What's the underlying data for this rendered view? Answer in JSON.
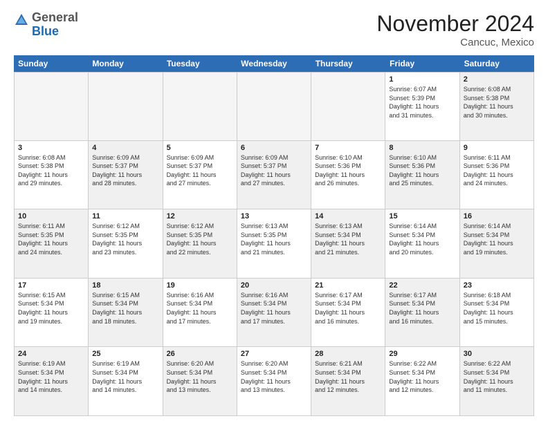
{
  "logo": {
    "general": "General",
    "blue": "Blue"
  },
  "header": {
    "month": "November 2024",
    "location": "Cancuc, Mexico"
  },
  "weekdays": [
    "Sunday",
    "Monday",
    "Tuesday",
    "Wednesday",
    "Thursday",
    "Friday",
    "Saturday"
  ],
  "rows": [
    [
      {
        "day": "",
        "info": "",
        "empty": true
      },
      {
        "day": "",
        "info": "",
        "empty": true
      },
      {
        "day": "",
        "info": "",
        "empty": true
      },
      {
        "day": "",
        "info": "",
        "empty": true
      },
      {
        "day": "",
        "info": "",
        "empty": true
      },
      {
        "day": "1",
        "info": "Sunrise: 6:07 AM\nSunset: 5:39 PM\nDaylight: 11 hours and 31 minutes.",
        "empty": false
      },
      {
        "day": "2",
        "info": "Sunrise: 6:08 AM\nSunset: 5:38 PM\nDaylight: 11 hours and 30 minutes.",
        "empty": false,
        "shaded": true
      }
    ],
    [
      {
        "day": "3",
        "info": "Sunrise: 6:08 AM\nSunset: 5:38 PM\nDaylight: 11 hours and 29 minutes.",
        "empty": false
      },
      {
        "day": "4",
        "info": "Sunrise: 6:09 AM\nSunset: 5:37 PM\nDaylight: 11 hours and 28 minutes.",
        "empty": false,
        "shaded": true
      },
      {
        "day": "5",
        "info": "Sunrise: 6:09 AM\nSunset: 5:37 PM\nDaylight: 11 hours and 27 minutes.",
        "empty": false
      },
      {
        "day": "6",
        "info": "Sunrise: 6:09 AM\nSunset: 5:37 PM\nDaylight: 11 hours and 27 minutes.",
        "empty": false,
        "shaded": true
      },
      {
        "day": "7",
        "info": "Sunrise: 6:10 AM\nSunset: 5:36 PM\nDaylight: 11 hours and 26 minutes.",
        "empty": false
      },
      {
        "day": "8",
        "info": "Sunrise: 6:10 AM\nSunset: 5:36 PM\nDaylight: 11 hours and 25 minutes.",
        "empty": false,
        "shaded": true
      },
      {
        "day": "9",
        "info": "Sunrise: 6:11 AM\nSunset: 5:36 PM\nDaylight: 11 hours and 24 minutes.",
        "empty": false
      }
    ],
    [
      {
        "day": "10",
        "info": "Sunrise: 6:11 AM\nSunset: 5:35 PM\nDaylight: 11 hours and 24 minutes.",
        "empty": false,
        "shaded": true
      },
      {
        "day": "11",
        "info": "Sunrise: 6:12 AM\nSunset: 5:35 PM\nDaylight: 11 hours and 23 minutes.",
        "empty": false
      },
      {
        "day": "12",
        "info": "Sunrise: 6:12 AM\nSunset: 5:35 PM\nDaylight: 11 hours and 22 minutes.",
        "empty": false,
        "shaded": true
      },
      {
        "day": "13",
        "info": "Sunrise: 6:13 AM\nSunset: 5:35 PM\nDaylight: 11 hours and 21 minutes.",
        "empty": false
      },
      {
        "day": "14",
        "info": "Sunrise: 6:13 AM\nSunset: 5:34 PM\nDaylight: 11 hours and 21 minutes.",
        "empty": false,
        "shaded": true
      },
      {
        "day": "15",
        "info": "Sunrise: 6:14 AM\nSunset: 5:34 PM\nDaylight: 11 hours and 20 minutes.",
        "empty": false
      },
      {
        "day": "16",
        "info": "Sunrise: 6:14 AM\nSunset: 5:34 PM\nDaylight: 11 hours and 19 minutes.",
        "empty": false,
        "shaded": true
      }
    ],
    [
      {
        "day": "17",
        "info": "Sunrise: 6:15 AM\nSunset: 5:34 PM\nDaylight: 11 hours and 19 minutes.",
        "empty": false
      },
      {
        "day": "18",
        "info": "Sunrise: 6:15 AM\nSunset: 5:34 PM\nDaylight: 11 hours and 18 minutes.",
        "empty": false,
        "shaded": true
      },
      {
        "day": "19",
        "info": "Sunrise: 6:16 AM\nSunset: 5:34 PM\nDaylight: 11 hours and 17 minutes.",
        "empty": false
      },
      {
        "day": "20",
        "info": "Sunrise: 6:16 AM\nSunset: 5:34 PM\nDaylight: 11 hours and 17 minutes.",
        "empty": false,
        "shaded": true
      },
      {
        "day": "21",
        "info": "Sunrise: 6:17 AM\nSunset: 5:34 PM\nDaylight: 11 hours and 16 minutes.",
        "empty": false
      },
      {
        "day": "22",
        "info": "Sunrise: 6:17 AM\nSunset: 5:34 PM\nDaylight: 11 hours and 16 minutes.",
        "empty": false,
        "shaded": true
      },
      {
        "day": "23",
        "info": "Sunrise: 6:18 AM\nSunset: 5:34 PM\nDaylight: 11 hours and 15 minutes.",
        "empty": false
      }
    ],
    [
      {
        "day": "24",
        "info": "Sunrise: 6:19 AM\nSunset: 5:34 PM\nDaylight: 11 hours and 14 minutes.",
        "empty": false,
        "shaded": true
      },
      {
        "day": "25",
        "info": "Sunrise: 6:19 AM\nSunset: 5:34 PM\nDaylight: 11 hours and 14 minutes.",
        "empty": false
      },
      {
        "day": "26",
        "info": "Sunrise: 6:20 AM\nSunset: 5:34 PM\nDaylight: 11 hours and 13 minutes.",
        "empty": false,
        "shaded": true
      },
      {
        "day": "27",
        "info": "Sunrise: 6:20 AM\nSunset: 5:34 PM\nDaylight: 11 hours and 13 minutes.",
        "empty": false
      },
      {
        "day": "28",
        "info": "Sunrise: 6:21 AM\nSunset: 5:34 PM\nDaylight: 11 hours and 12 minutes.",
        "empty": false,
        "shaded": true
      },
      {
        "day": "29",
        "info": "Sunrise: 6:22 AM\nSunset: 5:34 PM\nDaylight: 11 hours and 12 minutes.",
        "empty": false
      },
      {
        "day": "30",
        "info": "Sunrise: 6:22 AM\nSunset: 5:34 PM\nDaylight: 11 hours and 11 minutes.",
        "empty": false,
        "shaded": true
      }
    ]
  ]
}
